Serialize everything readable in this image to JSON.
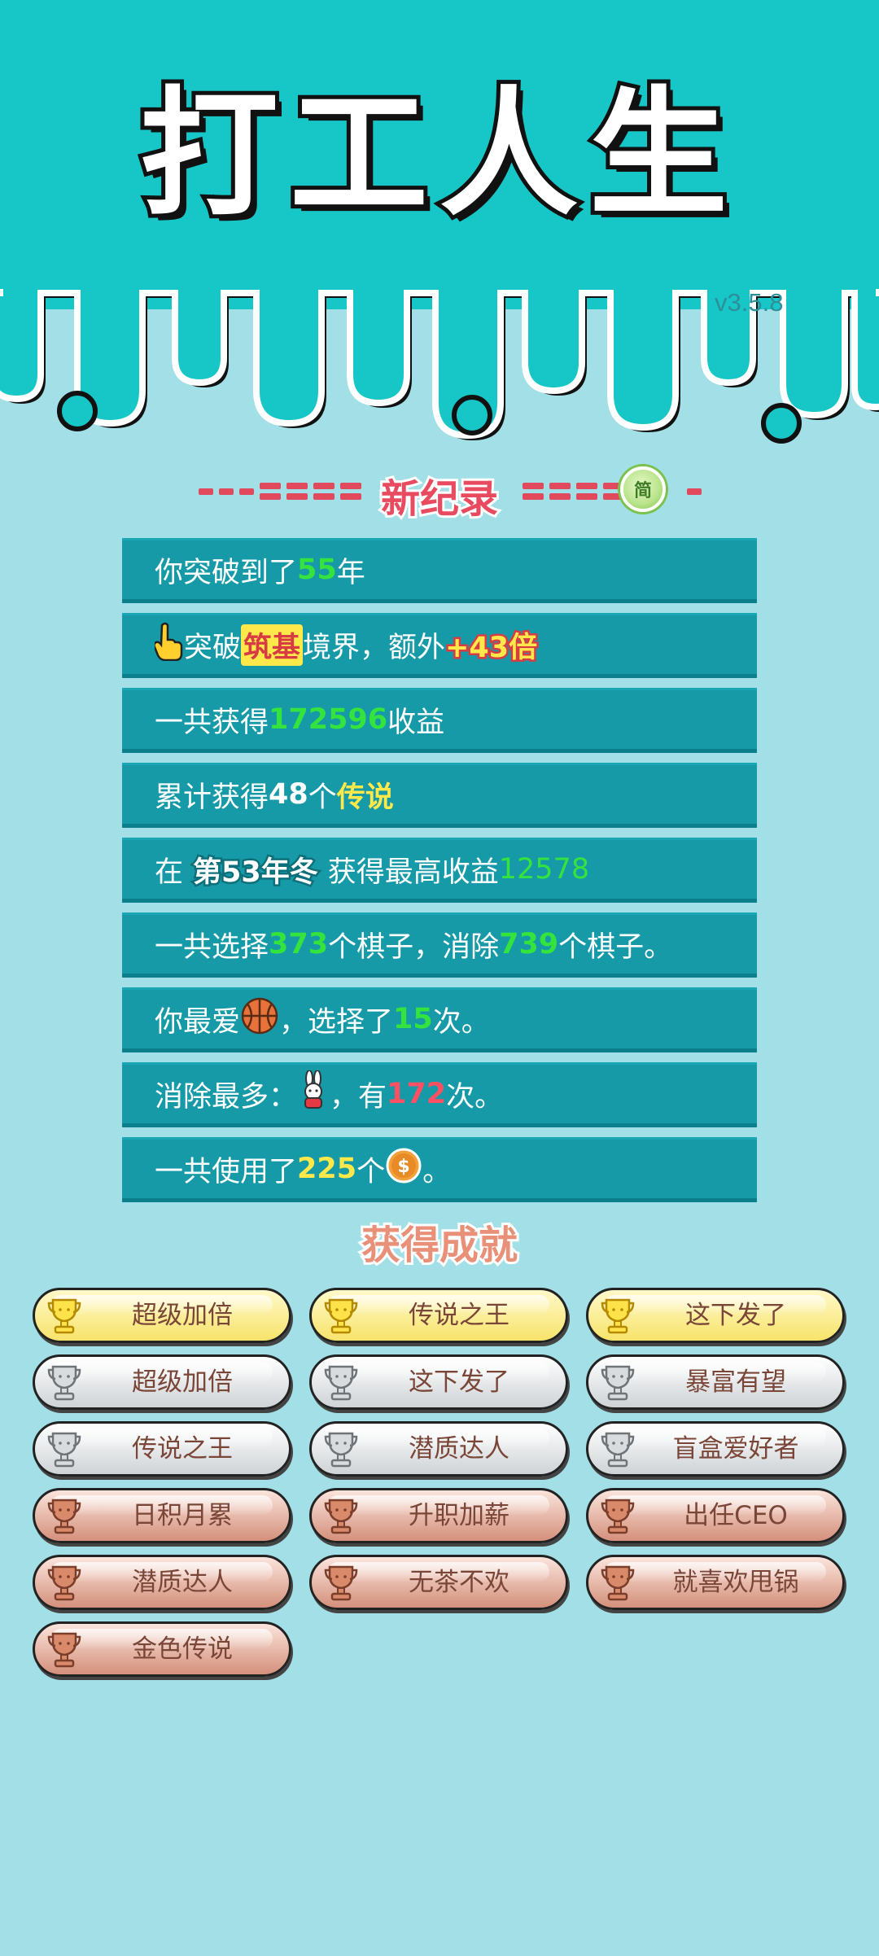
{
  "header": {
    "title": "打工人生",
    "version": "v3.5.8"
  },
  "record": {
    "title": "新纪录",
    "badge": "简"
  },
  "stats": [
    {
      "parts": [
        "你突破到了",
        "55",
        "年"
      ]
    },
    {
      "parts": [
        "突破",
        "筑基",
        "境界，额外",
        "+43倍"
      ]
    },
    {
      "parts": [
        "一共获得",
        "172596",
        "收益"
      ]
    },
    {
      "parts": [
        "累计获得",
        "48",
        "个",
        "传说"
      ]
    },
    {
      "parts": [
        "在",
        "第53年冬",
        "获得最高收益",
        "12578"
      ]
    },
    {
      "parts": [
        "一共选择",
        "373",
        "个棋子，消除",
        "739",
        "个棋子。"
      ]
    },
    {
      "parts": [
        "你最爱",
        "，选择了",
        "15",
        "次。"
      ]
    },
    {
      "parts": [
        "消除最多：",
        "，有",
        "172",
        "次。"
      ]
    },
    {
      "parts": [
        "一共使用了",
        "225",
        "个",
        "。"
      ]
    }
  ],
  "achievements_title": "获得成就",
  "achievements": [
    {
      "label": "超级加倍",
      "tier": "gold"
    },
    {
      "label": "传说之王",
      "tier": "gold"
    },
    {
      "label": "这下发了",
      "tier": "gold"
    },
    {
      "label": "超级加倍",
      "tier": "silver"
    },
    {
      "label": "这下发了",
      "tier": "silver"
    },
    {
      "label": "暴富有望",
      "tier": "silver"
    },
    {
      "label": "传说之王",
      "tier": "silver"
    },
    {
      "label": "潜质达人",
      "tier": "silver"
    },
    {
      "label": "盲盒爱好者",
      "tier": "silver"
    },
    {
      "label": "日积月累",
      "tier": "bronze"
    },
    {
      "label": "升职加薪",
      "tier": "bronze"
    },
    {
      "label": "出任CEO",
      "tier": "bronze"
    },
    {
      "label": "潜质达人",
      "tier": "bronze"
    },
    {
      "label": "无茶不欢",
      "tier": "bronze"
    },
    {
      "label": "就喜欢甩锅",
      "tier": "bronze"
    },
    {
      "label": "金色传说",
      "tier": "bronze"
    }
  ],
  "colors": {
    "header_bg": "#17c6c7",
    "page_bg": "#a2dfe6",
    "stat_row_bg": "#169aa7",
    "value_green": "#35e33f",
    "value_yellow": "#ffe94a",
    "value_red": "#ff4f63",
    "record_red": "#e84a5f",
    "achievement_title": "#e99078"
  },
  "icons": {
    "stat_2": "pointing-hand-icon",
    "stat_7": "basketball-icon",
    "stat_8": "rabbit-icon",
    "stat_9": "coin-icon",
    "achievement": "trophy-icon"
  }
}
